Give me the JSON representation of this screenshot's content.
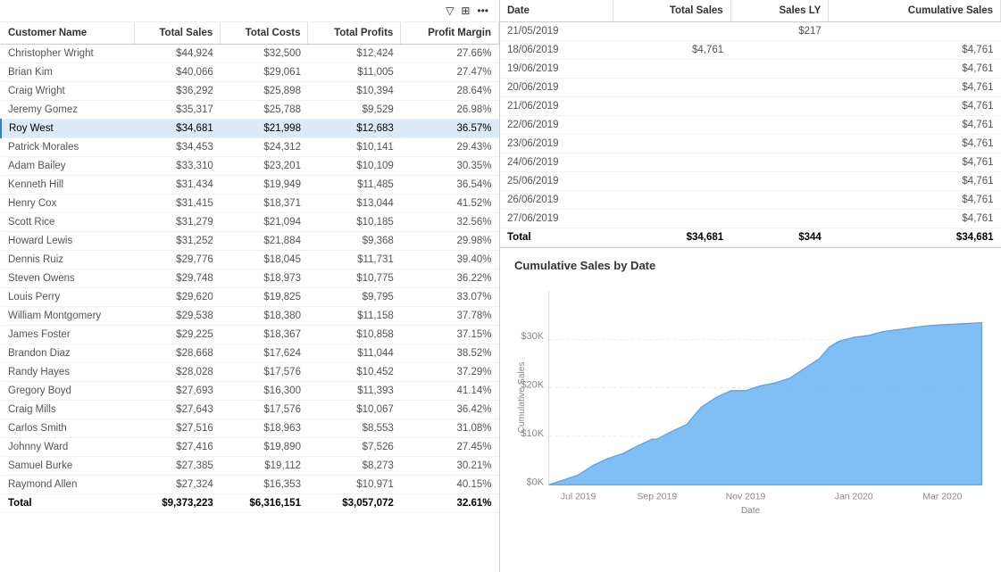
{
  "toolbar": {
    "filter_icon": "▽",
    "grid_icon": "⊞",
    "more_icon": "•••"
  },
  "left_table": {
    "columns": [
      "Customer Name",
      "Total Sales",
      "Total Costs",
      "Total Profits",
      "Profit Margin"
    ],
    "rows": [
      {
        "name": "Christopher Wright",
        "sales": "$44,924",
        "costs": "$32,500",
        "profits": "$12,424",
        "margin": "27.66%",
        "selected": false
      },
      {
        "name": "Brian Kim",
        "sales": "$40,066",
        "costs": "$29,061",
        "profits": "$11,005",
        "margin": "27.47%",
        "selected": false
      },
      {
        "name": "Craig Wright",
        "sales": "$36,292",
        "costs": "$25,898",
        "profits": "$10,394",
        "margin": "28.64%",
        "selected": false
      },
      {
        "name": "Jeremy Gomez",
        "sales": "$35,317",
        "costs": "$25,788",
        "profits": "$9,529",
        "margin": "26.98%",
        "selected": false
      },
      {
        "name": "Roy West",
        "sales": "$34,681",
        "costs": "$21,998",
        "profits": "$12,683",
        "margin": "36.57%",
        "selected": true
      },
      {
        "name": "Patrick Morales",
        "sales": "$34,453",
        "costs": "$24,312",
        "profits": "$10,141",
        "margin": "29.43%",
        "selected": false
      },
      {
        "name": "Adam Bailey",
        "sales": "$33,310",
        "costs": "$23,201",
        "profits": "$10,109",
        "margin": "30.35%",
        "selected": false
      },
      {
        "name": "Kenneth Hill",
        "sales": "$31,434",
        "costs": "$19,949",
        "profits": "$11,485",
        "margin": "36.54%",
        "selected": false
      },
      {
        "name": "Henry Cox",
        "sales": "$31,415",
        "costs": "$18,371",
        "profits": "$13,044",
        "margin": "41.52%",
        "selected": false
      },
      {
        "name": "Scott Rice",
        "sales": "$31,279",
        "costs": "$21,094",
        "profits": "$10,185",
        "margin": "32.56%",
        "selected": false
      },
      {
        "name": "Howard Lewis",
        "sales": "$31,252",
        "costs": "$21,884",
        "profits": "$9,368",
        "margin": "29.98%",
        "selected": false
      },
      {
        "name": "Dennis Ruiz",
        "sales": "$29,776",
        "costs": "$18,045",
        "profits": "$11,731",
        "margin": "39.40%",
        "selected": false
      },
      {
        "name": "Steven Owens",
        "sales": "$29,748",
        "costs": "$18,973",
        "profits": "$10,775",
        "margin": "36.22%",
        "selected": false
      },
      {
        "name": "Louis Perry",
        "sales": "$29,620",
        "costs": "$19,825",
        "profits": "$9,795",
        "margin": "33.07%",
        "selected": false
      },
      {
        "name": "William Montgomery",
        "sales": "$29,538",
        "costs": "$18,380",
        "profits": "$11,158",
        "margin": "37.78%",
        "selected": false
      },
      {
        "name": "James Foster",
        "sales": "$29,225",
        "costs": "$18,367",
        "profits": "$10,858",
        "margin": "37.15%",
        "selected": false
      },
      {
        "name": "Brandon Diaz",
        "sales": "$28,668",
        "costs": "$17,624",
        "profits": "$11,044",
        "margin": "38.52%",
        "selected": false
      },
      {
        "name": "Randy Hayes",
        "sales": "$28,028",
        "costs": "$17,576",
        "profits": "$10,452",
        "margin": "37.29%",
        "selected": false
      },
      {
        "name": "Gregory Boyd",
        "sales": "$27,693",
        "costs": "$16,300",
        "profits": "$11,393",
        "margin": "41.14%",
        "selected": false
      },
      {
        "name": "Craig Mills",
        "sales": "$27,643",
        "costs": "$17,576",
        "profits": "$10,067",
        "margin": "36.42%",
        "selected": false
      },
      {
        "name": "Carlos Smith",
        "sales": "$27,516",
        "costs": "$18,963",
        "profits": "$8,553",
        "margin": "31.08%",
        "selected": false
      },
      {
        "name": "Johnny Ward",
        "sales": "$27,416",
        "costs": "$19,890",
        "profits": "$7,526",
        "margin": "27.45%",
        "selected": false
      },
      {
        "name": "Samuel Burke",
        "sales": "$27,385",
        "costs": "$19,112",
        "profits": "$8,273",
        "margin": "30.21%",
        "selected": false
      },
      {
        "name": "Raymond Allen",
        "sales": "$27,324",
        "costs": "$16,353",
        "profits": "$10,971",
        "margin": "40.15%",
        "selected": false
      }
    ],
    "total": {
      "label": "Total",
      "sales": "$9,373,223",
      "costs": "$6,316,151",
      "profits": "$3,057,072",
      "margin": "32.61%"
    }
  },
  "right_table": {
    "columns": [
      "Date",
      "Total Sales",
      "Sales LY",
      "Cumulative Sales"
    ],
    "rows": [
      {
        "date": "21/05/2019",
        "sales": "",
        "sales_ly": "$217",
        "cum_sales": ""
      },
      {
        "date": "18/06/2019",
        "sales": "$4,761",
        "sales_ly": "",
        "cum_sales": "$4,761"
      },
      {
        "date": "19/06/2019",
        "sales": "",
        "sales_ly": "",
        "cum_sales": "$4,761"
      },
      {
        "date": "20/06/2019",
        "sales": "",
        "sales_ly": "",
        "cum_sales": "$4,761"
      },
      {
        "date": "21/06/2019",
        "sales": "",
        "sales_ly": "",
        "cum_sales": "$4,761"
      },
      {
        "date": "22/06/2019",
        "sales": "",
        "sales_ly": "",
        "cum_sales": "$4,761"
      },
      {
        "date": "23/06/2019",
        "sales": "",
        "sales_ly": "",
        "cum_sales": "$4,761"
      },
      {
        "date": "24/06/2019",
        "sales": "",
        "sales_ly": "",
        "cum_sales": "$4,761"
      },
      {
        "date": "25/06/2019",
        "sales": "",
        "sales_ly": "",
        "cum_sales": "$4,761"
      },
      {
        "date": "26/06/2019",
        "sales": "",
        "sales_ly": "",
        "cum_sales": "$4,761"
      },
      {
        "date": "27/06/2019",
        "sales": "",
        "sales_ly": "",
        "cum_sales": "$4,761"
      }
    ],
    "total": {
      "label": "Total",
      "sales": "$34,681",
      "sales_ly": "$344",
      "cum_sales": "$34,681"
    }
  },
  "chart": {
    "title": "Cumulative Sales by Date",
    "y_axis_label": "Cumulative Sales",
    "x_axis_label": "Date",
    "y_ticks": [
      "$0K",
      "$10K",
      "$20K",
      "$30K"
    ],
    "x_ticks": [
      "Jul 2019",
      "Sep 2019",
      "Nov 2019",
      "Jan 2020",
      "Mar 2020"
    ],
    "color": "#6ab4f5"
  }
}
